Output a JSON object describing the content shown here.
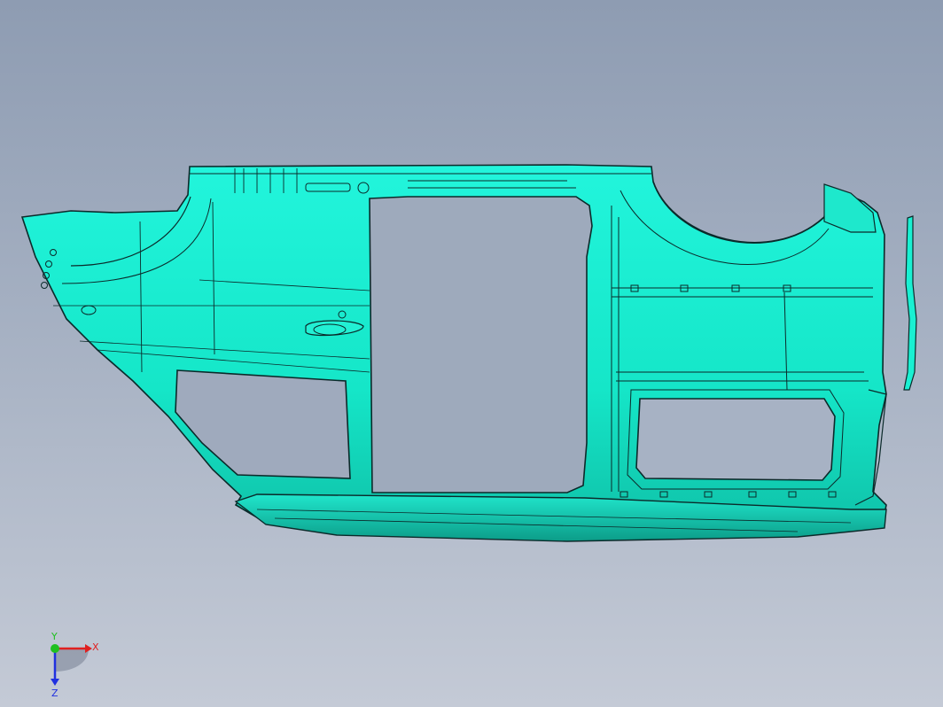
{
  "viewport": {
    "background_top": "#8e9cb2",
    "background_bottom": "#c4cad6"
  },
  "model": {
    "fill": "#19f0d2",
    "fill_shade": "#10c8ae",
    "edge": "#0b2a2a"
  },
  "triad": {
    "x_label": "X",
    "y_label": "Y",
    "z_label": "Z",
    "x_color": "#e02020",
    "y_color": "#20c020",
    "z_color": "#2030e0"
  }
}
